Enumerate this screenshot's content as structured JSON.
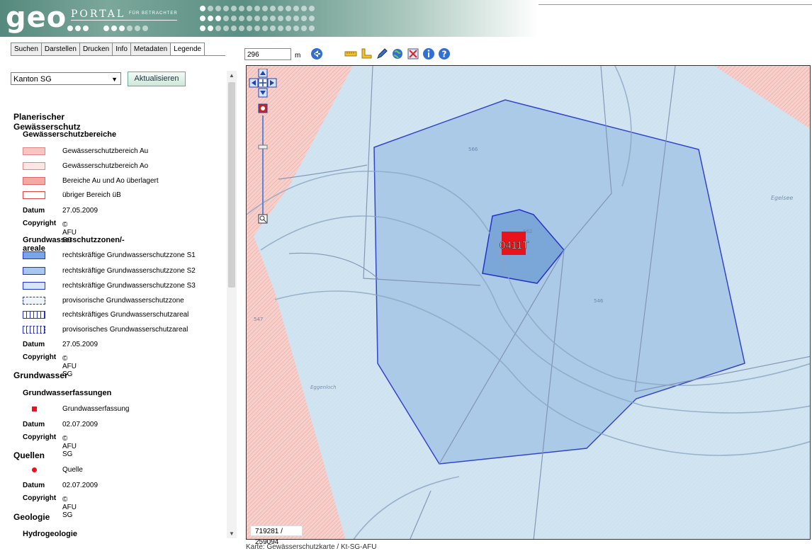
{
  "header": {
    "logo": "geo",
    "portal": "PORTAL",
    "sub": "FÜR BETRACHTER"
  },
  "tabs": [
    "Suchen",
    "Darstellen",
    "Drucken",
    "Info",
    "Metadaten",
    "Legende"
  ],
  "active_tab": "Legende",
  "area_select": "Kanton SG",
  "update_button": "Aktualisieren",
  "legend": {
    "section1": "Planerischer Gewässerschutz",
    "sub1": "Gewässerschutzbereiche",
    "sub1_items": [
      "Gewässerschutzbereich Au",
      "Gewässerschutzbereich Ao",
      "Bereiche Au und Ao überlagert",
      "übriger Bereich üB"
    ],
    "sub2": "Grundwasserschutzzonen/-areale",
    "sub2_items": [
      "rechtskräftige Grundwasserschutzzone S1",
      "rechtskräftige Grundwasserschutzzone S2",
      "rechtskräftige Grundwasserschutzzone S3",
      "provisorische Grundwasserschutzzone",
      "rechtskräftiges Grundwasserschutzareal",
      "provisorisches Grundwasserschutzareal"
    ],
    "section2": "Grundwasser",
    "sub3": "Grundwasserfassungen",
    "sub3_item": "Grundwasserfassung",
    "section3": "Quellen",
    "sub4_item": "Quelle",
    "section4": "Geologie",
    "sub5": "Hydrogeologie",
    "datum_label": "Datum",
    "copyright_label": "Copyright",
    "copyright_value": "© AFU SG",
    "dates": [
      "27.05.2009",
      "27.05.2009",
      "02.07.2009",
      "02.07.2009"
    ]
  },
  "map": {
    "scale_value": "296",
    "scale_unit": "m",
    "label": "0411T",
    "coords": "719281 / 259094",
    "caption": "Karte: Gewässerschutzkarte / Kt-SG-AFU",
    "place_label_1": "Egelsee",
    "place_label_2": "Eggenloch",
    "heights": [
      "566",
      "562",
      "546",
      "547"
    ]
  },
  "colors": {
    "au": "#f8c6c2",
    "ao": "#fde6e4",
    "overlap": "#f4a9a3",
    "zone_s1": "#7aa6e8",
    "zone_s2": "#a8c6f0",
    "zone_s3": "#d6e6f8",
    "zone_border": "#2233cc",
    "marker": "#e8141b"
  }
}
